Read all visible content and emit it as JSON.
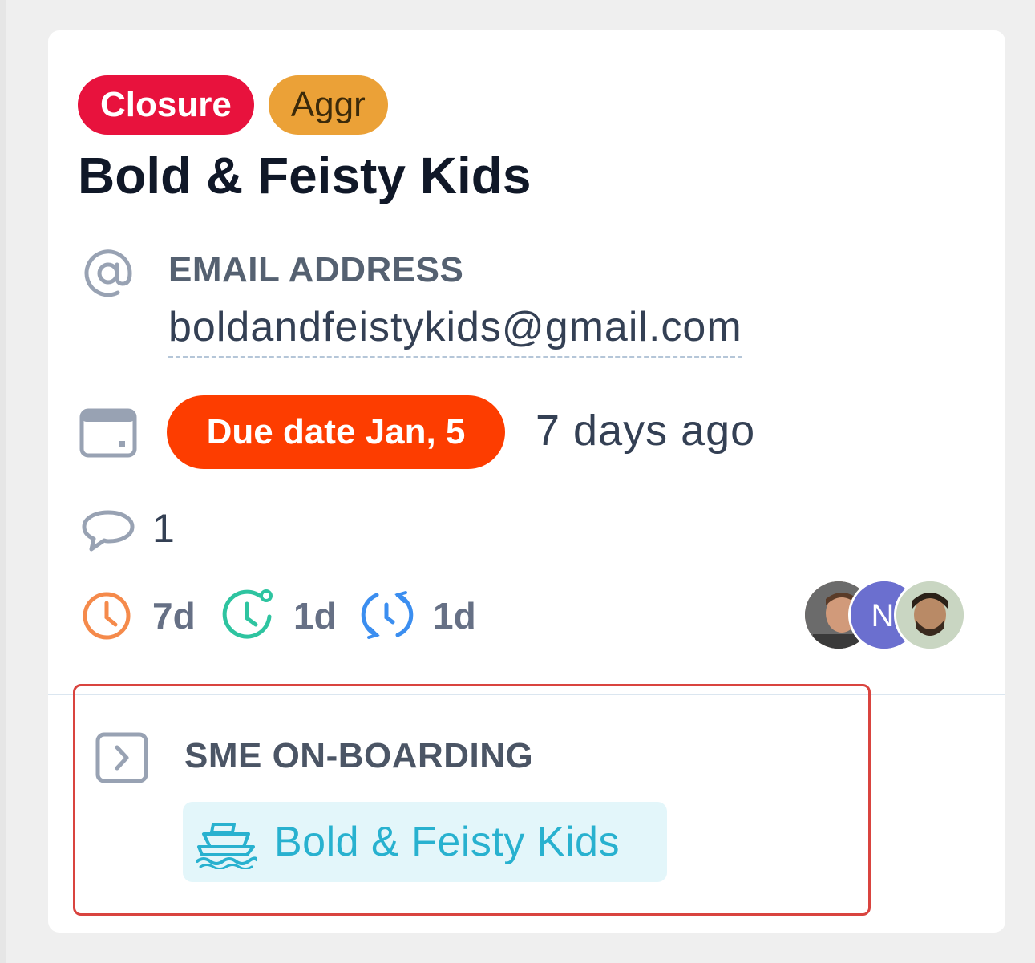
{
  "card": {
    "tags": [
      {
        "label": "Closure",
        "color": "#e8123d"
      },
      {
        "label": "Aggr",
        "color": "#eba137"
      }
    ],
    "title": "Bold & Feisty Kids",
    "email": {
      "icon": "at-sign-icon",
      "label": "EMAIL ADDRESS",
      "value": "boldandfeistykids@gmail.com"
    },
    "due": {
      "icon": "calendar-icon",
      "badge": "Due date Jan, 5",
      "relative": "7 days ago",
      "badge_color": "#fd3d00"
    },
    "comments": {
      "icon": "comment-icon",
      "count": "1"
    },
    "metrics": [
      {
        "icon": "clock-icon",
        "value": "7d",
        "color": "#f58a4b"
      },
      {
        "icon": "clock-check-icon",
        "value": "1d",
        "color": "#2ec4a0"
      },
      {
        "icon": "refresh-clock-icon",
        "value": "1d",
        "color": "#3b8ef0"
      }
    ],
    "assignees": [
      {
        "type": "photo",
        "name": "assignee-1"
      },
      {
        "type": "initial",
        "initial": "N",
        "color": "#6b6fcf"
      },
      {
        "type": "photo",
        "name": "assignee-3"
      }
    ],
    "section": {
      "icon": "chevron-right-box-icon",
      "title": "SME ON-BOARDING",
      "item_icon": "ship-icon",
      "item_label": "Bold & Feisty Kids"
    }
  }
}
